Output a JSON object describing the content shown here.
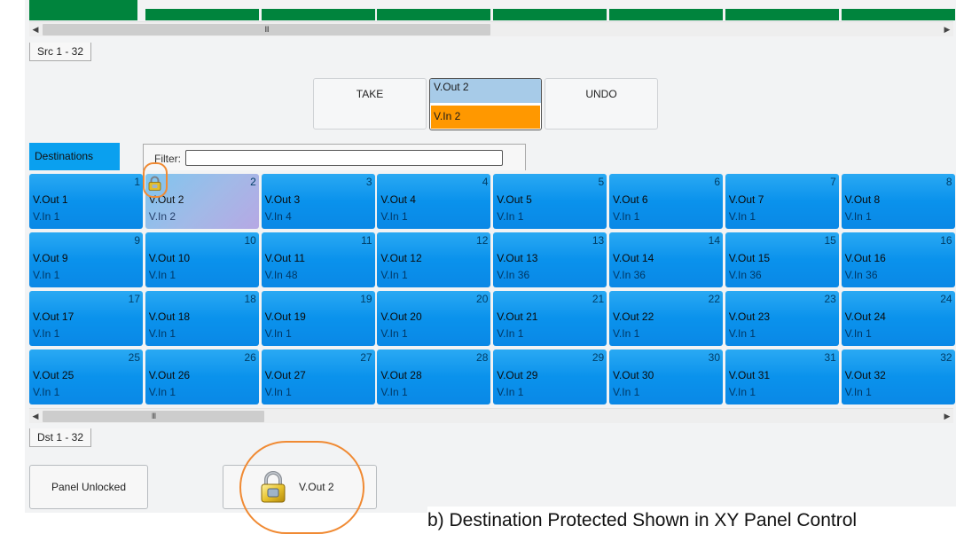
{
  "sources": {
    "tile_count": 8,
    "range_label": "Src 1 - 32",
    "scroll_thumb_glyph": "III"
  },
  "controls": {
    "take_label": "TAKE",
    "undo_label": "UNDO",
    "preview_destination": "V.Out 2",
    "preview_source": "V.In 2"
  },
  "destinations": {
    "tab_label": "Destinations",
    "filter_label": "Filter:",
    "filter_value": "",
    "range_label": "Dst 1 - 32",
    "scroll_thumb_glyph": "III",
    "cells": [
      {
        "num": "1",
        "dst": "V.Out 1",
        "src": "V.In 1"
      },
      {
        "num": "2",
        "dst": "V.Out 2",
        "src": "V.In 2",
        "protected": true
      },
      {
        "num": "3",
        "dst": "V.Out 3",
        "src": "V.In 4"
      },
      {
        "num": "4",
        "dst": "V.Out 4",
        "src": "V.In 1"
      },
      {
        "num": "5",
        "dst": "V.Out 5",
        "src": "V.In 1"
      },
      {
        "num": "6",
        "dst": "V.Out 6",
        "src": "V.In 1"
      },
      {
        "num": "7",
        "dst": "V.Out 7",
        "src": "V.In 1"
      },
      {
        "num": "8",
        "dst": "V.Out 8",
        "src": "V.In 1"
      },
      {
        "num": "9",
        "dst": "V.Out 9",
        "src": "V.In 1"
      },
      {
        "num": "10",
        "dst": "V.Out 10",
        "src": "V.In 1"
      },
      {
        "num": "11",
        "dst": "V.Out 11",
        "src": "V.In 48"
      },
      {
        "num": "12",
        "dst": "V.Out 12",
        "src": "V.In 1"
      },
      {
        "num": "13",
        "dst": "V.Out 13",
        "src": "V.In 36"
      },
      {
        "num": "14",
        "dst": "V.Out 14",
        "src": "V.In 36"
      },
      {
        "num": "15",
        "dst": "V.Out 15",
        "src": "V.In 36"
      },
      {
        "num": "16",
        "dst": "V.Out 16",
        "src": "V.In 36"
      },
      {
        "num": "17",
        "dst": "V.Out 17",
        "src": "V.In 1"
      },
      {
        "num": "18",
        "dst": "V.Out 18",
        "src": "V.In 1"
      },
      {
        "num": "19",
        "dst": "V.Out 19",
        "src": "V.In 1"
      },
      {
        "num": "20",
        "dst": "V.Out 20",
        "src": "V.In 1"
      },
      {
        "num": "21",
        "dst": "V.Out 21",
        "src": "V.In 1"
      },
      {
        "num": "22",
        "dst": "V.Out 22",
        "src": "V.In 1"
      },
      {
        "num": "23",
        "dst": "V.Out 23",
        "src": "V.In 1"
      },
      {
        "num": "24",
        "dst": "V.Out 24",
        "src": "V.In 1"
      },
      {
        "num": "25",
        "dst": "V.Out 25",
        "src": "V.In 1"
      },
      {
        "num": "26",
        "dst": "V.Out 26",
        "src": "V.In 1"
      },
      {
        "num": "27",
        "dst": "V.Out 27",
        "src": "V.In 1"
      },
      {
        "num": "28",
        "dst": "V.Out 28",
        "src": "V.In 1"
      },
      {
        "num": "29",
        "dst": "V.Out 29",
        "src": "V.In 1"
      },
      {
        "num": "30",
        "dst": "V.Out 30",
        "src": "V.In 1"
      },
      {
        "num": "31",
        "dst": "V.Out 31",
        "src": "V.In 1"
      },
      {
        "num": "32",
        "dst": "V.Out 32",
        "src": "V.In 1"
      }
    ]
  },
  "footer": {
    "panel_lock_label": "Panel Unlocked",
    "protect_button_label": "V.Out 2",
    "protect_icon": "padlock-icon"
  },
  "caption": "b) Destination Protected Shown in XY Panel Control",
  "colors": {
    "source_tile": "#00843d",
    "destination_tile": "#0a92ec",
    "preview_destination": "#a7cbe8",
    "preview_source": "#ff9800",
    "highlight_ring": "#f08a33"
  }
}
